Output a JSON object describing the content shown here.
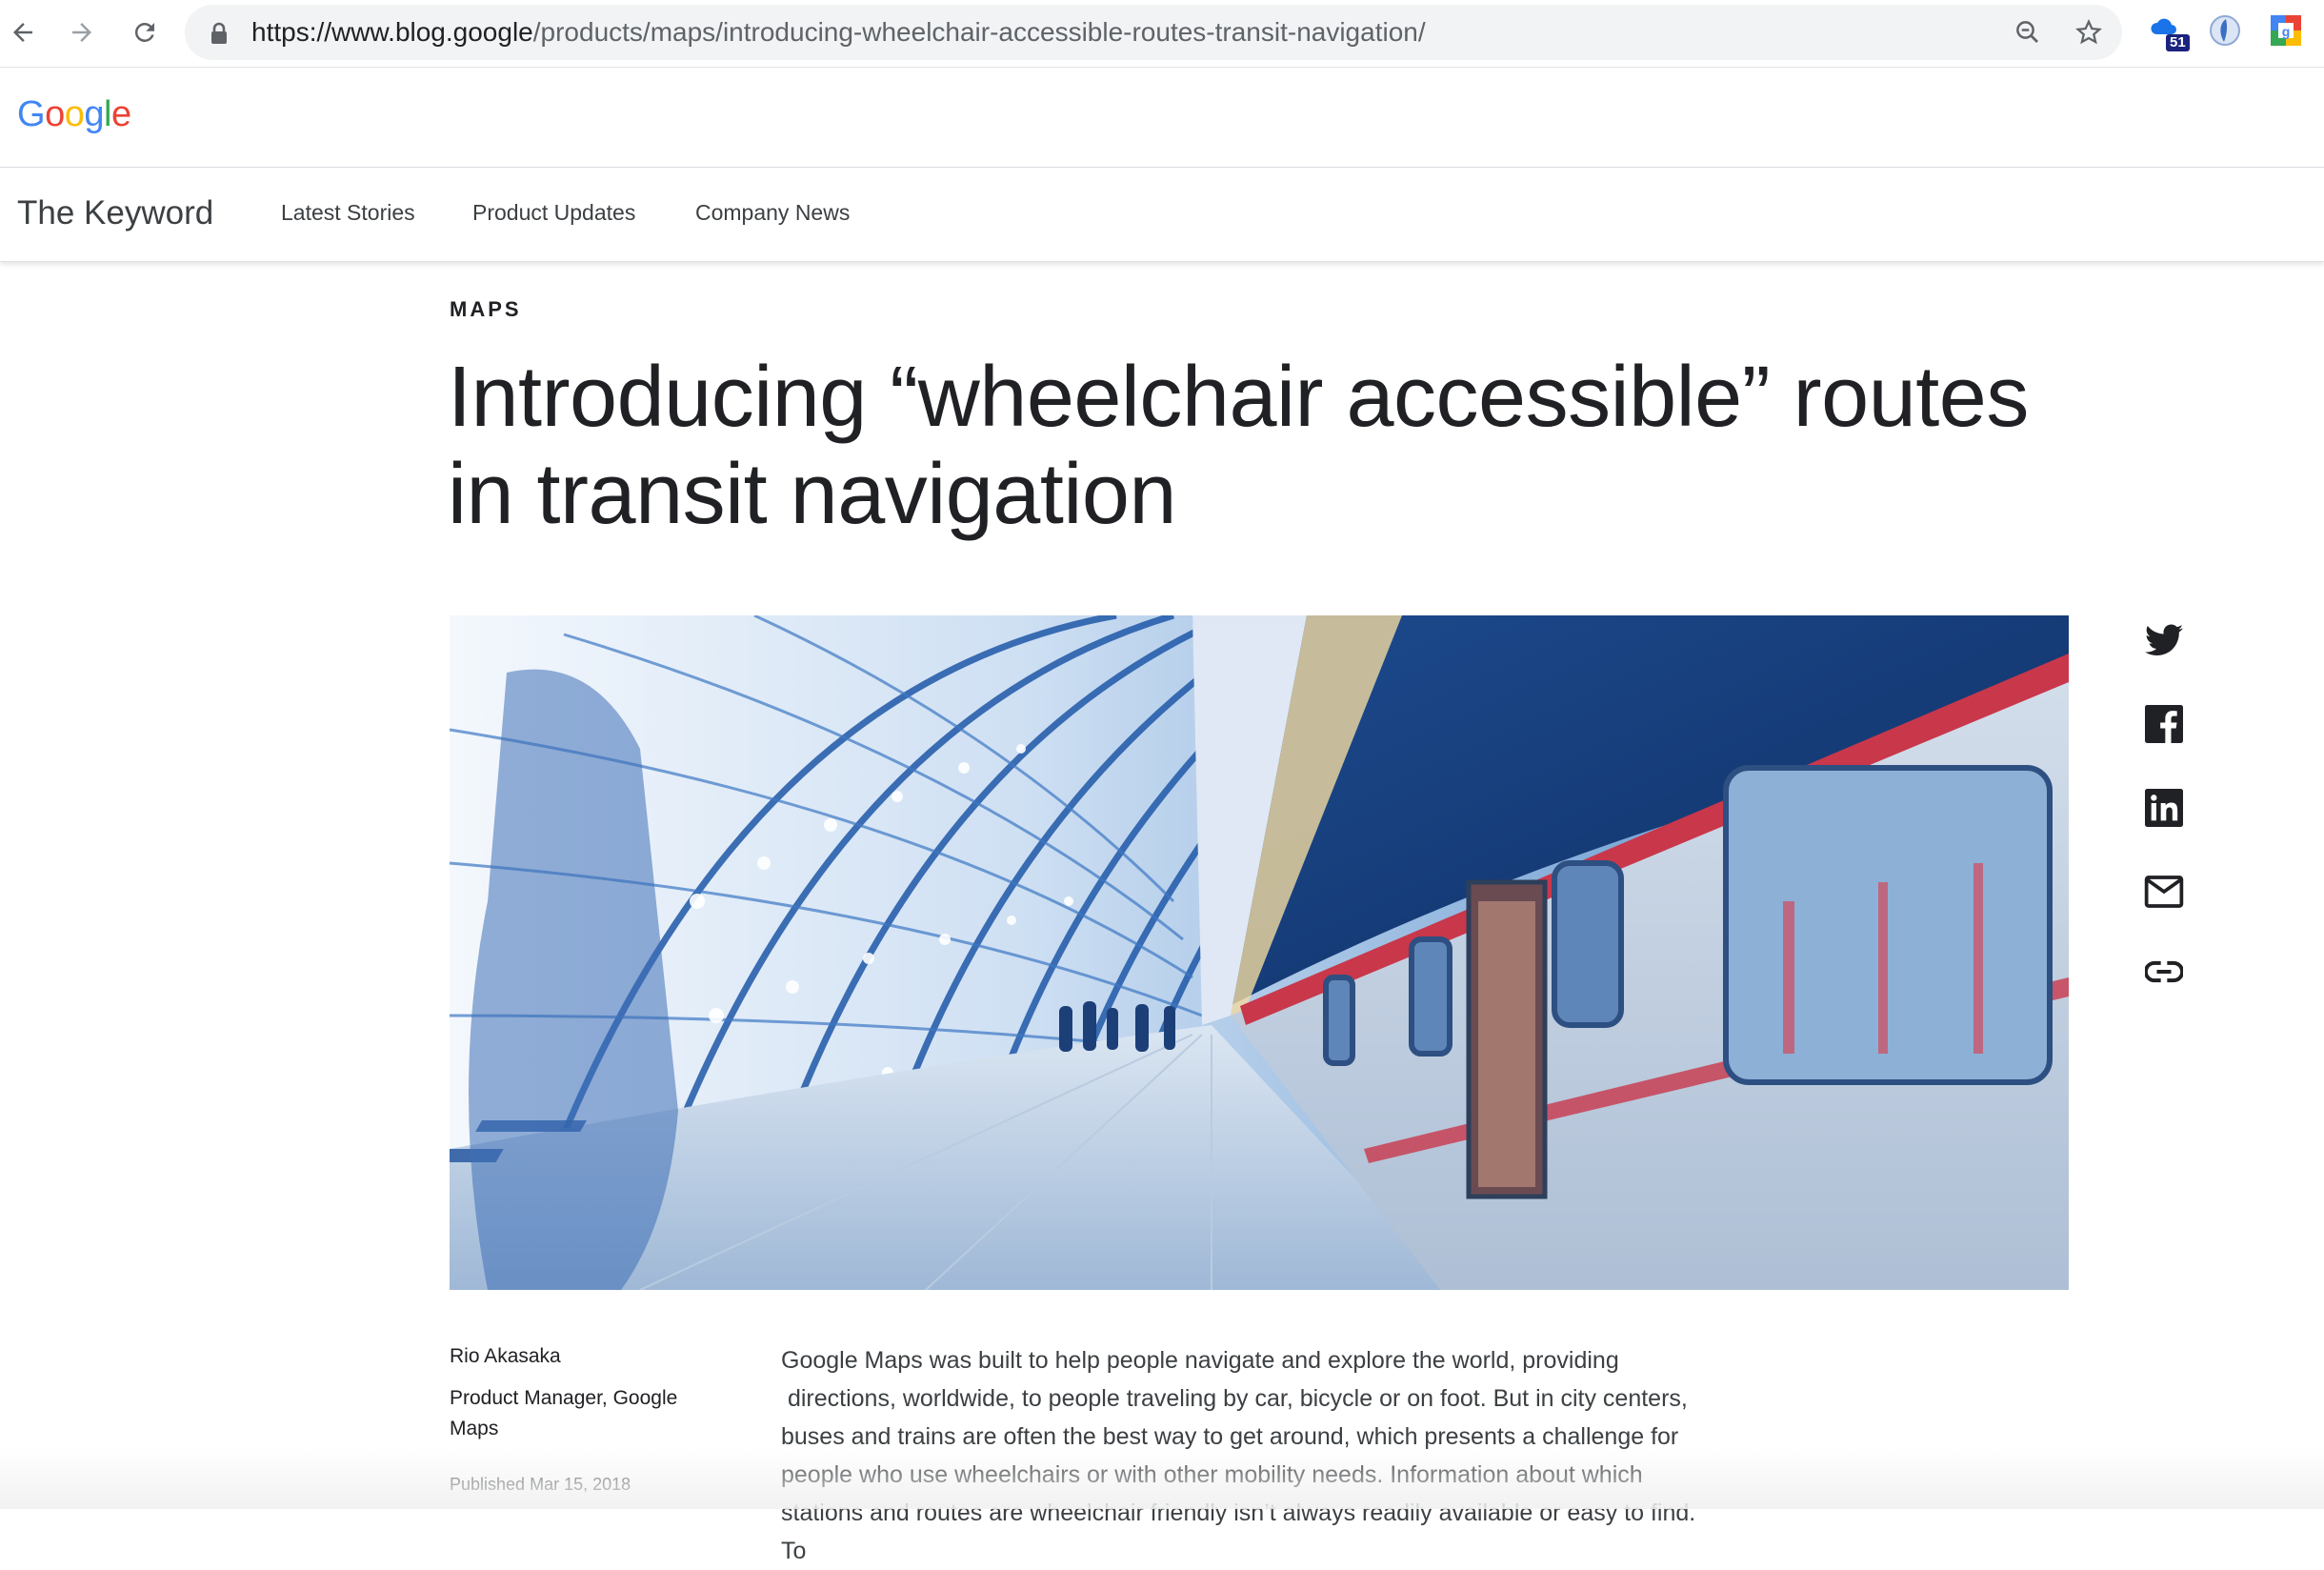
{
  "browser": {
    "url_host": "https://www.blog.google",
    "url_path": "/products/maps/introducing-wheelchair-accessible-routes-transit-navigation/",
    "extension_badge": "51"
  },
  "logo": {
    "letters": [
      "G",
      "o",
      "o",
      "g",
      "l",
      "e"
    ],
    "colors": [
      "#4285F4",
      "#EA4335",
      "#FBBC05",
      "#4285F4",
      "#34A853",
      "#EA4335"
    ]
  },
  "nav": {
    "site_title": "The Keyword",
    "links": [
      "Latest Stories",
      "Product Updates",
      "Company News"
    ]
  },
  "article": {
    "category": "MAPS",
    "headline_line1": "Introducing “wheelchair accessible” routes",
    "headline_line2": "in transit navigation",
    "author_name": "Rio Akasaka",
    "author_role": "Product Manager, Google Maps",
    "published_label": "Published",
    "published_date": "Mar 15, 2018",
    "body_lines": [
      "Google Maps was built to help people navigate and explore the world, providing",
      " directions, worldwide, to people traveling by car, bicycle or on foot. But in city centers,",
      "buses and trains are often the best way to get around, which presents a challenge for",
      "people who use wheelchairs or with other mobility needs. Information about which",
      "stations and routes are wheelchair friendly isn’t always readily available or easy to find. To"
    ]
  },
  "share_icons": [
    "twitter-icon",
    "facebook-icon",
    "linkedin-icon",
    "mail-icon",
    "link-icon"
  ],
  "colors": {
    "text_dark": "#202124",
    "text_muted": "#5f6368",
    "chrome_bg": "#f1f3f4"
  }
}
